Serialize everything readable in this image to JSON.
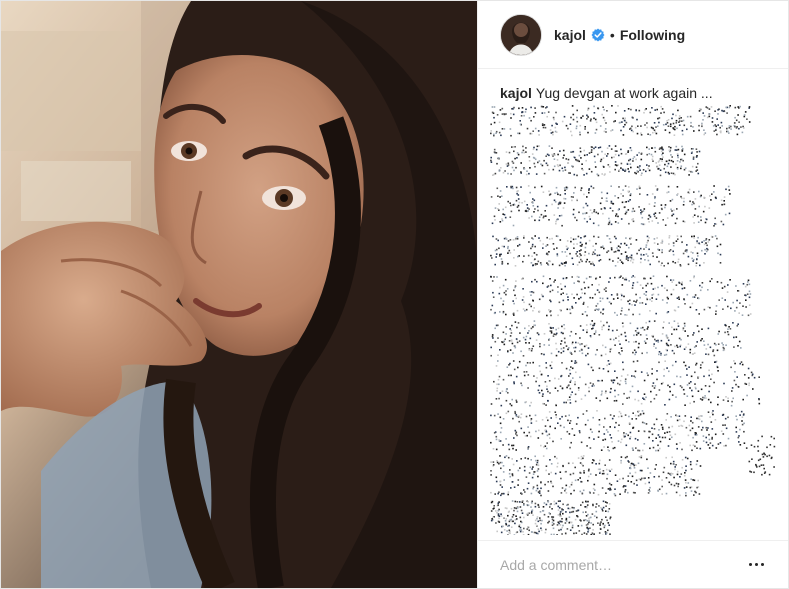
{
  "post": {
    "author": {
      "username": "kajol",
      "avatar_icon": "profile-avatar",
      "verified_icon": "verified-badge-icon",
      "follow_state": "Following",
      "separator": "•"
    },
    "caption": {
      "username": "kajol",
      "text": "Yug devgan at work again ..."
    },
    "comment_box": {
      "placeholder": "Add a comment…"
    },
    "more_options_icon": "more-horizontal-icon"
  },
  "colors": {
    "text": "#262626",
    "verified_blue": "#3897f0",
    "placeholder": "#a8a8a8",
    "divider": "#efefef"
  }
}
